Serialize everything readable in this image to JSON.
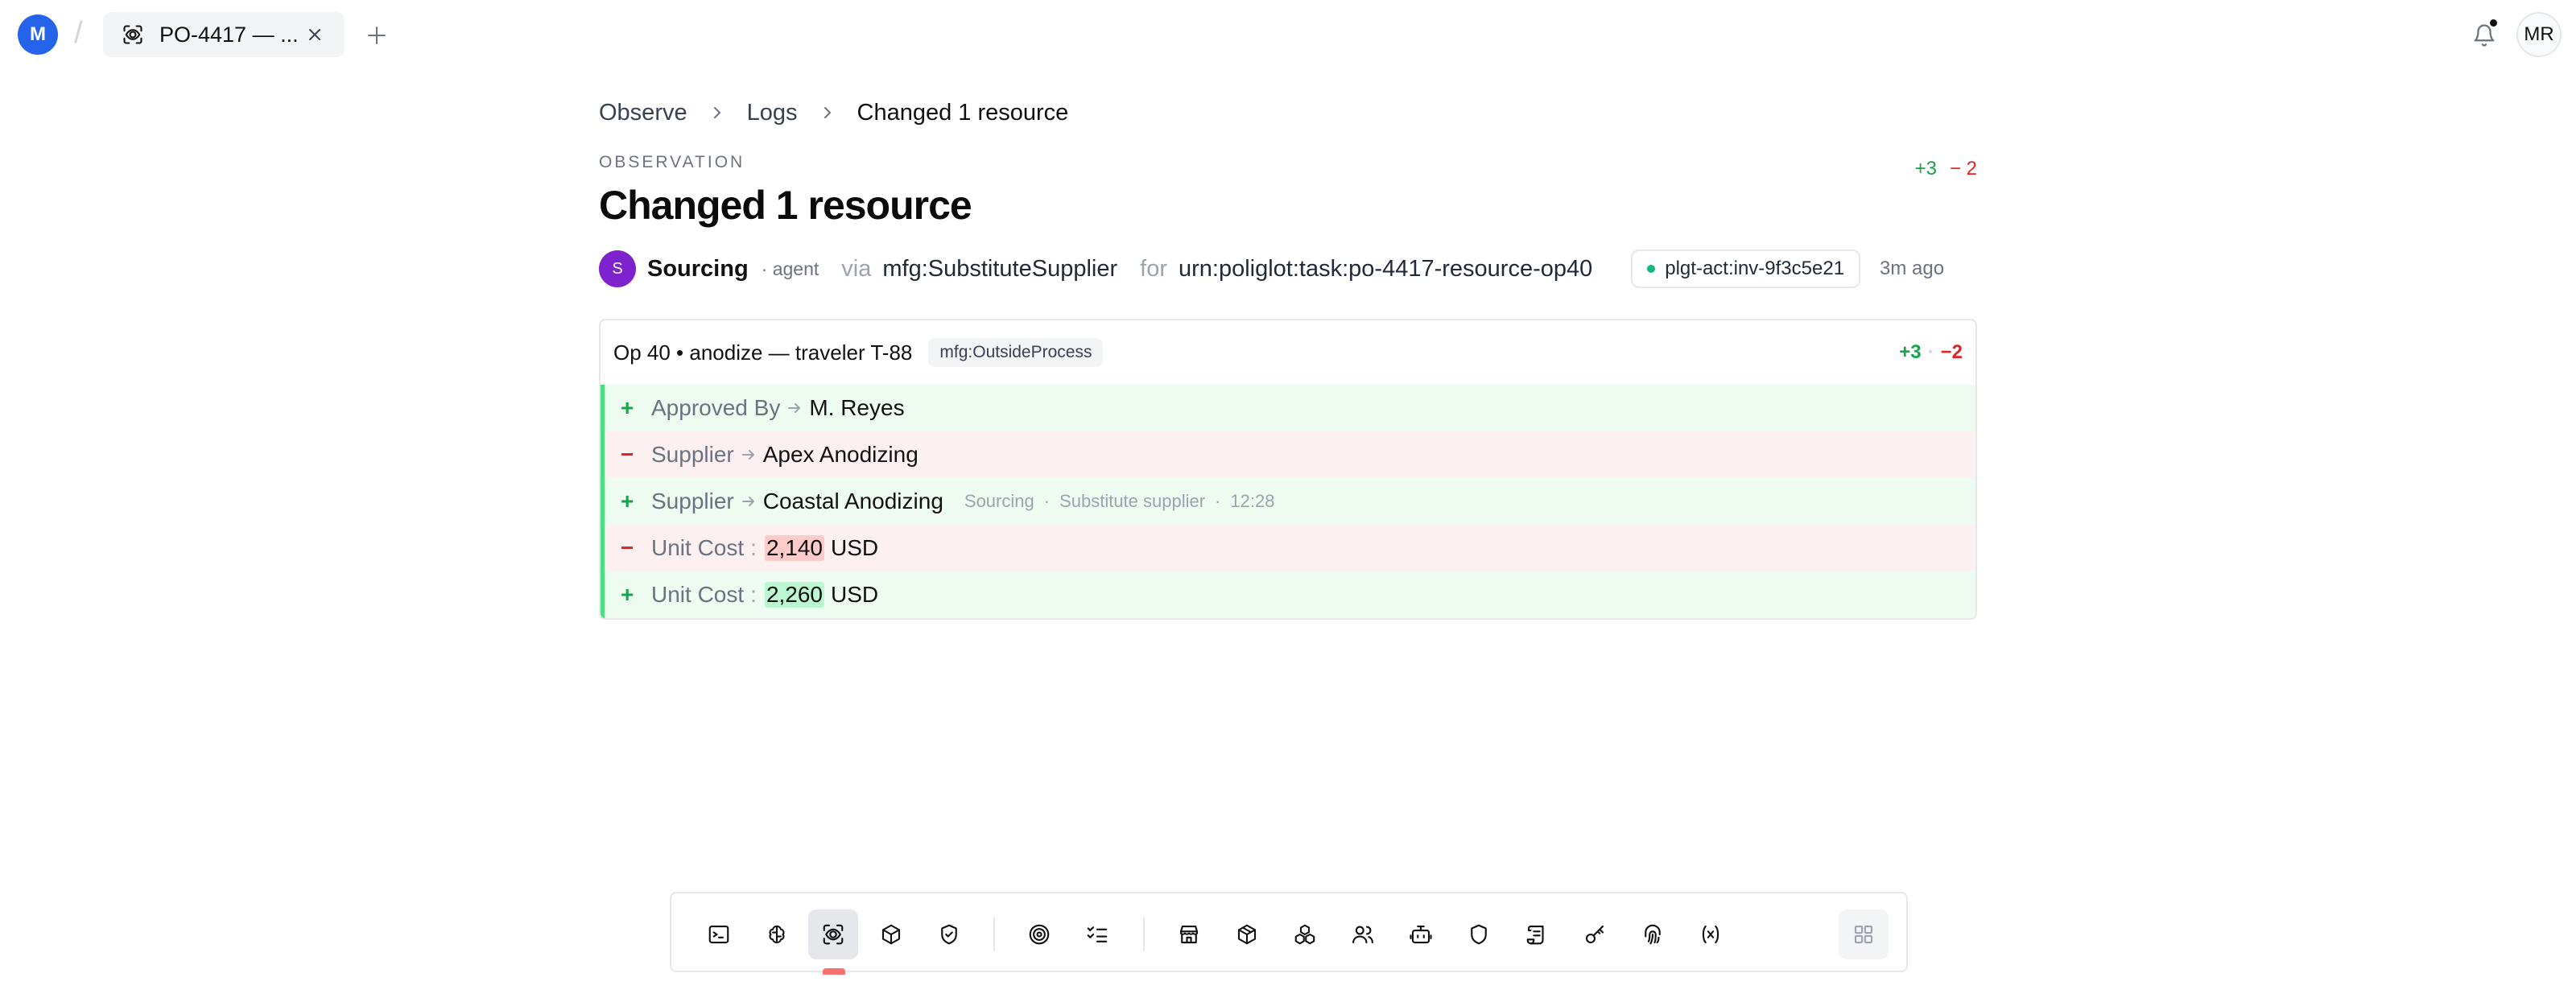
{
  "topbar": {
    "workspace_initial": "M",
    "tab_title": "PO-4417 — ...",
    "user_initials": "MR"
  },
  "breadcrumb": {
    "items": [
      "Observe",
      "Logs",
      "Changed 1 resource"
    ]
  },
  "observation": {
    "label": "OBSERVATION",
    "title": "Changed 1 resource",
    "added_count": "+3",
    "removed_count": "− 2",
    "agent_initial": "S",
    "agent_name": "Sourcing",
    "agent_role": "· agent",
    "via_label": "via",
    "via_value": "mfg:SubstituteSupplier",
    "for_label": "for",
    "for_value": "urn:poliglot:task:po-4417-resource-op40",
    "action_id": "plgt-act:inv-9f3c5e21",
    "time_ago": "3m ago"
  },
  "resource": {
    "name": "Op 40 • anodize — traveler T-88",
    "type": "mfg:OutsideProcess",
    "added": "+3",
    "removed": "−2",
    "changes": [
      {
        "sign": "+",
        "field": "Approved By",
        "value": "M. Reyes"
      },
      {
        "sign": "−",
        "field": "Supplier",
        "value": "Apex Anodizing"
      },
      {
        "sign": "+",
        "field": "Supplier",
        "value": "Coastal Anodizing",
        "prov_agent": "Sourcing",
        "prov_action": "Substitute supplier",
        "prov_time": "12:28"
      },
      {
        "sign": "−",
        "field": "Unit Cost",
        "value": "2,140",
        "unit": "USD"
      },
      {
        "sign": "+",
        "field": "Unit Cost",
        "value": "2,260",
        "unit": "USD"
      }
    ]
  },
  "dock": {
    "icons": [
      "terminal-icon",
      "brain-icon",
      "observe-icon",
      "cube-icon",
      "shield-check-icon",
      "target-icon",
      "checklist-icon",
      "store-icon",
      "package-icon",
      "cubes-icon",
      "users-icon",
      "robot-icon",
      "shield-icon",
      "scroll-icon",
      "key-icon",
      "fingerprint-icon",
      "variable-icon",
      "grid-icon"
    ],
    "active": "observe-icon"
  },
  "colors": {
    "accent_blue": "#2563eb",
    "agent_purple": "#7e22ce",
    "add_green": "#16a34a",
    "remove_red": "#dc2626",
    "status_dot": "#10b981"
  }
}
